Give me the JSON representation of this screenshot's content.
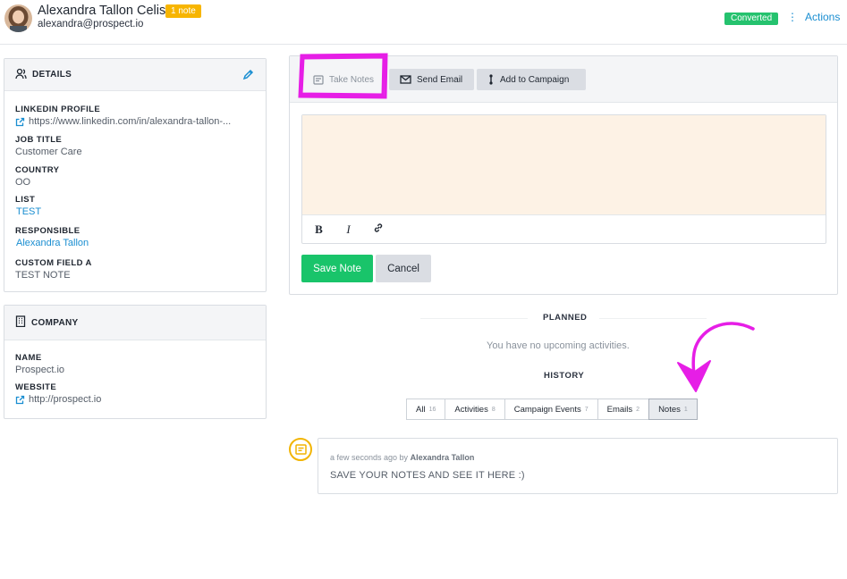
{
  "header": {
    "name": "Alexandra Tallon Celis",
    "note_badge": "1 note",
    "email": "alexandra@prospect.io",
    "status_badge": "Converted",
    "actions_label": "Actions"
  },
  "details": {
    "title": "DETAILS",
    "fields": [
      {
        "label": "LINKEDIN PROFILE",
        "value": "https://www.linkedin.com/in/alexandra-tallon-..."
      },
      {
        "label": "JOB TITLE",
        "value": "Customer Care"
      },
      {
        "label": "COUNTRY",
        "value": "OO"
      },
      {
        "label": "LIST",
        "value": "TEST"
      },
      {
        "label": "RESPONSIBLE",
        "value": "Alexandra Tallon"
      },
      {
        "label": "CUSTOM FIELD A",
        "value": "TEST NOTE"
      }
    ]
  },
  "company": {
    "title": "COMPANY",
    "fields": [
      {
        "label": "NAME",
        "value": "Prospect.io"
      },
      {
        "label": "WEBSITE",
        "value": "http://prospect.io"
      }
    ]
  },
  "composer": {
    "tabs": [
      "Take Notes",
      "Send Email",
      "Add to Campaign"
    ],
    "save_label": "Save Note",
    "cancel_label": "Cancel",
    "tools": [
      "B",
      "I"
    ]
  },
  "planned": {
    "title": "PLANNED",
    "empty": "You have no upcoming activities."
  },
  "history": {
    "title": "HISTORY",
    "filters": [
      {
        "label": "All",
        "count": "16"
      },
      {
        "label": "Activities",
        "count": "8"
      },
      {
        "label": "Campaign Events",
        "count": "7"
      },
      {
        "label": "Emails",
        "count": "2"
      },
      {
        "label": "Notes",
        "count": "1"
      }
    ],
    "note": {
      "time": "a few seconds ago by",
      "author": "Alexandra Tallon",
      "text": "SAVE YOUR NOTES AND SEE IT HERE :)"
    }
  },
  "colors": {
    "accent": "#1a8ed1",
    "success": "#19c46a",
    "warning": "#f7b500",
    "annotation": "#e61ee6"
  }
}
